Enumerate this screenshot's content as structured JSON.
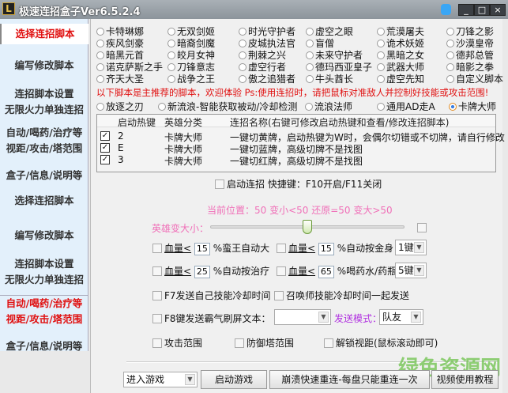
{
  "window": {
    "title": "极速连招盒子Ver6.5.2.4",
    "logo": "L",
    "minimize": "_",
    "maximize": "□",
    "close": "×"
  },
  "sidebar": {
    "items": [
      {
        "label": "选择连招脚本",
        "active": true
      },
      {
        "label": "编写修改脚本"
      },
      {
        "label": "连招脚本设置"
      },
      {
        "label": "无限火力单独连招"
      },
      {
        "label": "自动/喝药/治疗等"
      },
      {
        "label": "视距/攻击/塔范围"
      },
      {
        "label": "盒子/信息/说明等"
      },
      {
        "label": "选择连招脚本"
      },
      {
        "label": "编写修改脚本"
      },
      {
        "label": "连招脚本设置"
      },
      {
        "label": "无限火力单独连招"
      },
      {
        "label": "自动/喝药/治疗等",
        "red": true
      },
      {
        "label": "视距/攻击/塔范围",
        "red": true
      },
      {
        "label": "盒子/信息/说明等"
      }
    ]
  },
  "heroes": [
    [
      "卡特琳娜",
      "无双剑姬",
      "时光守护者",
      "虚空之眼",
      "荒漠屠夫",
      "刀锋之影"
    ],
    [
      "疾风剑豪",
      "暗裔剑魔",
      "皮城执法官",
      "盲僧",
      "诡术妖姬",
      "沙漠皇帝"
    ],
    [
      "暗黑元首",
      "皎月女神",
      "荆棘之兴",
      "未来守护者",
      "黑暗之女",
      "德邦总管"
    ],
    [
      "诺克萨斯之手",
      "刀锋意志",
      "虚空行者",
      "德玛西亚皇子",
      "武器大师",
      "暗影之拳"
    ],
    [
      "齐天大圣",
      "战争之王",
      "傲之追猎者",
      "牛头酋长",
      "虚空先知",
      "自定义脚本"
    ]
  ],
  "notice": "以下脚本是主推荐的脚本，欢迎体验 Ps:使用连招时，请把鼠标对准敌人并控制好技能或攻击范围!",
  "recommended": [
    {
      "label": "放逐之刃"
    },
    {
      "label": "新流浪-智能获取被动/冷却检测"
    },
    {
      "label": "流浪法师"
    },
    {
      "label": "通用AD走A"
    },
    {
      "label": "卡牌大师",
      "selected": true
    }
  ],
  "table": {
    "headers": [
      "启动热键",
      "英雄分类",
      "连招名称(右键可修改启动热键和查看/修改连招脚本)"
    ],
    "rows": [
      {
        "checked": true,
        "hotkey": "2",
        "hero": "卡牌大师",
        "name": "一键切黄牌，启动热键为W时，会偶尔切错或不切牌，请自行修改"
      },
      {
        "checked": true,
        "hotkey": "E",
        "hero": "卡牌大师",
        "name": "一键切蓝牌，高级切牌不是找图"
      },
      {
        "checked": true,
        "hotkey": "3",
        "hero": "卡牌大师",
        "name": "一键切红牌，高级切牌不是找图"
      }
    ]
  },
  "start_combo": "启动连招 快捷键：F10开启/F11关闭",
  "position_text": "当前位置：50 变小<50 还原=50 变大>50",
  "hero_size_label": "英雄变大小：",
  "hero_size_value": 50,
  "settings": {
    "hp_label": "血量<",
    "r1a_value": "15",
    "r1a_text": "%蛮王自动大",
    "r1b_value": "15",
    "r1b_text": "%自动按金身 ：",
    "r1b_key": "1键",
    "r2a_value": "25",
    "r2a_text": "%自动按治疗",
    "r2b_value": "65",
    "r2b_text": "%喝药水/药瓶：",
    "r2b_key": "5键",
    "f7": "F7发送自己技能冷却时间",
    "summoner": "召唤师技能冷却时间一起发送",
    "f8": "F8键发送霸气刷屏文本：",
    "send_mode_label": "发送模式：",
    "send_mode": "队友",
    "attack_range": "攻击范围",
    "tower_range": "防御塔范围",
    "unlock_view": "解锁视距(鼠标滚动即可)"
  },
  "bottom": {
    "enter_game": "进入游戏",
    "start_game": "启动游戏",
    "reconnect": "崩溃快速重连-每盘只能重连一次",
    "tutorial": "视频使用教程"
  },
  "watermark": "绿色资源网",
  "colors": {
    "red": "#e01010",
    "pink": "#f070b8",
    "purple": "#b030e0"
  }
}
